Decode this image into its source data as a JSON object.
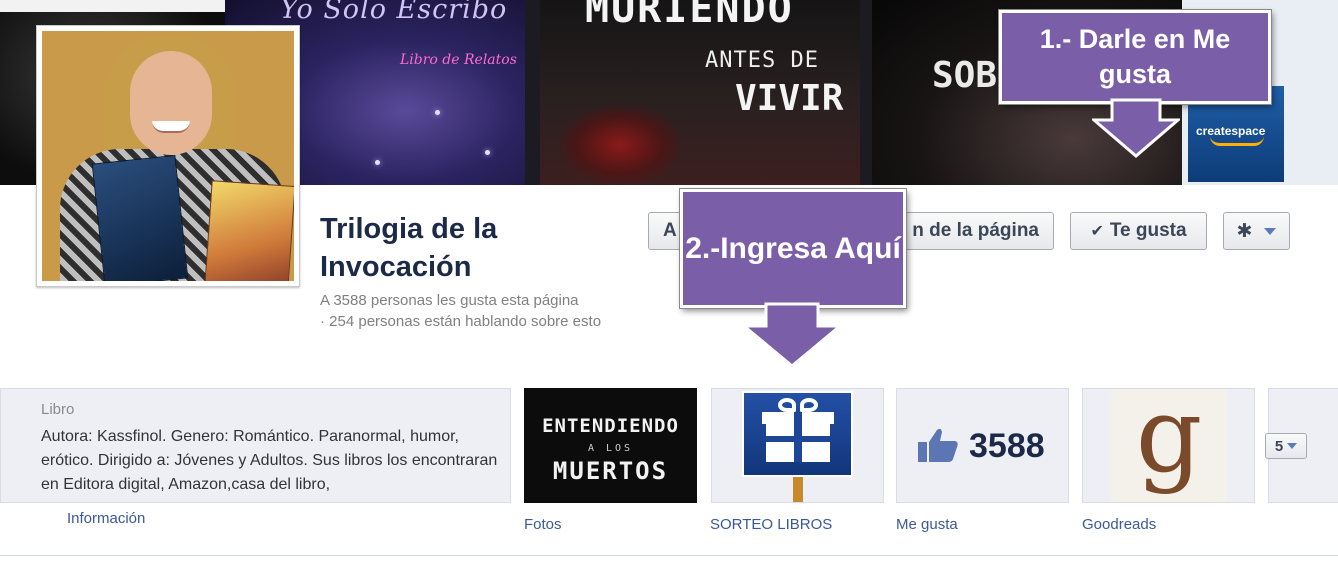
{
  "cover": {
    "panel_b": {
      "title": "Yo Solo Escribo",
      "subtitle": "Libro de Relatos"
    },
    "panel_c": {
      "line1": "MURIENDO",
      "line2": "ANTES DE",
      "line3": "VIVIR"
    },
    "panel_d": {
      "line1": "SOB"
    },
    "panel_e": {
      "brand": "createspace"
    }
  },
  "page": {
    "name": "Trilogia de la Invocación",
    "likes_text": "A 3588 personas les gusta esta página",
    "talking_text": "· 254 personas están hablando sobre esto"
  },
  "actions": {
    "button1_label": "A",
    "button2_label": "n de la página",
    "like_button_label": "Te gusta",
    "like_check_icon": "check-icon",
    "settings_icon": "gear-icon"
  },
  "about": {
    "category": "Libro",
    "description": "Autora: Kassfinol. Genero: Romántico. Paranormal, humor, erótico. Dirigido a: Jóvenes y Adultos. Sus libros los encontraran en Editora digital, Amazon,casa del libro,",
    "link_label": "Información"
  },
  "apps": {
    "fotos": {
      "label": "Fotos",
      "img_line1": "ENTENDIENDO",
      "img_line2": "A LOS",
      "img_line3": "MUERTOS"
    },
    "sorteo": {
      "label": "SORTEO LIBROS",
      "icon": "gift-icon"
    },
    "megusta": {
      "label": "Me gusta",
      "count": "3588",
      "icon": "thumbs-up-icon"
    },
    "goodreads": {
      "label": "Goodreads",
      "logo_letter": "g"
    },
    "more": {
      "count": "5"
    }
  },
  "callouts": {
    "step1": "1.- Darle en Me gusta",
    "step2": "2.-Ingresa Aquí"
  },
  "colors": {
    "callout_bg": "#7b5ea8",
    "link": "#3b5998",
    "page_name": "#1c2a47",
    "tile_bg": "#edeff4"
  }
}
